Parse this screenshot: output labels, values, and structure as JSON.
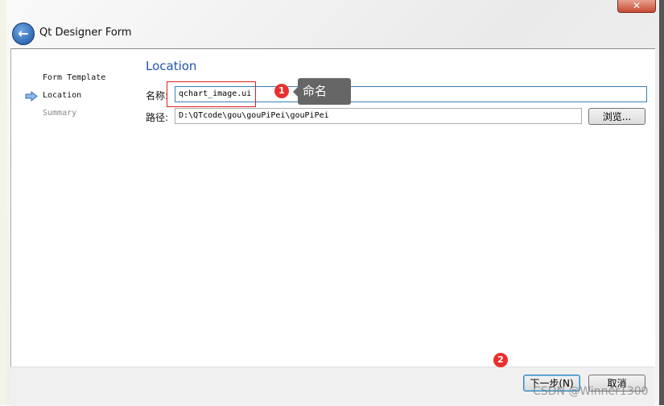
{
  "window": {
    "title": "Qt Designer Form",
    "close_icon": "close-icon",
    "back_icon": "back-arrow-icon"
  },
  "nav": {
    "items": [
      {
        "label": "Form Template",
        "state": "done"
      },
      {
        "label": "Location",
        "state": "current"
      },
      {
        "label": "Summary",
        "state": "pending"
      }
    ]
  },
  "page": {
    "heading": "Location",
    "name_label": "名称:",
    "name_value": "qchart_image.ui",
    "path_label": "路径:",
    "path_value": "D:\\QTcode\\gou\\gouPiPei\\gouPiPei",
    "browse_label": "浏览..."
  },
  "annotations": {
    "badge1": "1",
    "tooltip": "命名",
    "badge2": "2",
    "badge_color": "#e8312f"
  },
  "footer": {
    "next_label": "下一步(N)",
    "cancel_label": "取消"
  },
  "watermark": "CSDN @Winner1300"
}
